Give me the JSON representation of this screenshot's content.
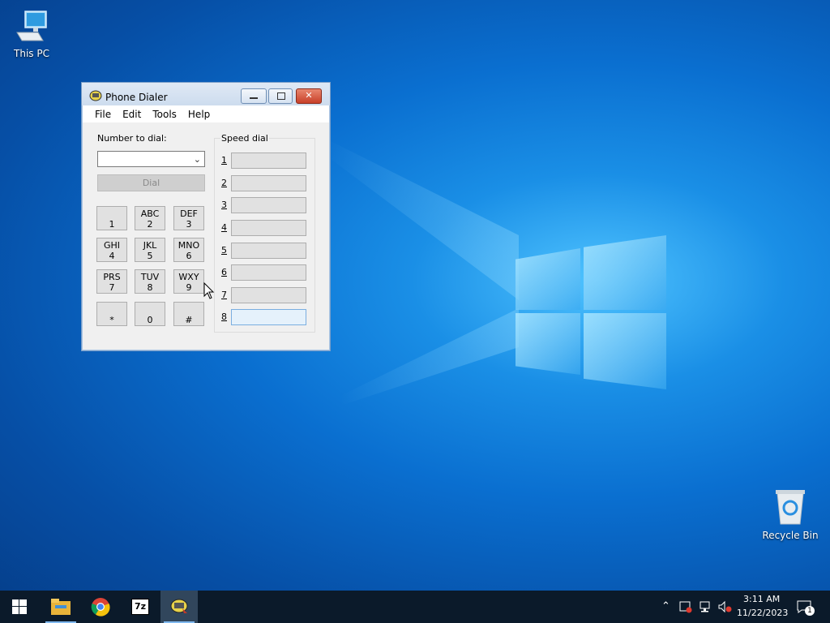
{
  "desktop": {
    "icons": [
      {
        "label": "This PC",
        "icon": "computer-icon"
      },
      {
        "label": "Recycle Bin",
        "icon": "recycle-bin-icon"
      }
    ]
  },
  "window": {
    "title": "Phone Dialer",
    "menu": [
      "File",
      "Edit",
      "Tools",
      "Help"
    ],
    "number_label": "Number to dial:",
    "number_value": "",
    "dial_label": "Dial",
    "speed_label": "Speed dial",
    "keys": [
      {
        "letters": "",
        "digit": "1"
      },
      {
        "letters": "ABC",
        "digit": "2"
      },
      {
        "letters": "DEF",
        "digit": "3"
      },
      {
        "letters": "GHI",
        "digit": "4"
      },
      {
        "letters": "JKL",
        "digit": "5"
      },
      {
        "letters": "MNO",
        "digit": "6"
      },
      {
        "letters": "PRS",
        "digit": "7"
      },
      {
        "letters": "TUV",
        "digit": "8"
      },
      {
        "letters": "WXY",
        "digit": "9"
      },
      {
        "letters": "",
        "digit": "*"
      },
      {
        "letters": "",
        "digit": "0"
      },
      {
        "letters": "",
        "digit": "#"
      }
    ],
    "speed_dial": [
      "1",
      "2",
      "3",
      "4",
      "5",
      "6",
      "7",
      "8"
    ]
  },
  "taskbar": {
    "apps": [
      "start-icon",
      "file-explorer-icon",
      "chrome-icon",
      "7zip-icon",
      "phone-dialer-icon"
    ],
    "seven_zip_label": "7z",
    "time": "3:11 AM",
    "date": "11/22/2023",
    "notification_count": "1"
  }
}
